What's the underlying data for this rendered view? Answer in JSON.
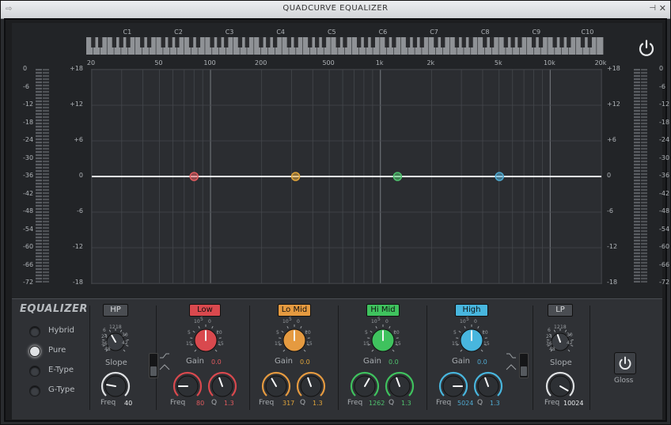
{
  "window": {
    "title": "QUADCURVE EQUALIZER",
    "pin_icon": "pin-icon",
    "close_icon": "close-icon"
  },
  "graph": {
    "notes": [
      "C1",
      "C2",
      "C3",
      "C4",
      "C5",
      "C6",
      "C7",
      "C8",
      "C9",
      "C10"
    ],
    "freq_labels": [
      "20",
      "50",
      "100",
      "200",
      "500",
      "1k",
      "2k",
      "5k",
      "10k",
      "20k"
    ],
    "db_labels": [
      "+18",
      "+12",
      "+6",
      "0",
      "-6",
      "-12",
      "-18"
    ],
    "meter_labels": [
      "0",
      "-6",
      "-12",
      "-18",
      "-24",
      "-30",
      "-36",
      "-42",
      "-48",
      "-54",
      "-60",
      "-66",
      "-72"
    ],
    "curve_gain_db": 0,
    "bands": [
      {
        "name": "Low",
        "freq_hz": 80,
        "color": "#e05a5e"
      },
      {
        "name": "Lo Mid",
        "freq_hz": 317,
        "color": "#e0a43a"
      },
      {
        "name": "Hi Mid",
        "freq_hz": 1262,
        "color": "#4fc26e"
      },
      {
        "name": "High",
        "freq_hz": 5024,
        "color": "#4fa9d0"
      }
    ]
  },
  "controls": {
    "title": "EQUALIZER",
    "modes": [
      {
        "label": "Hybrid",
        "selected": false
      },
      {
        "label": "Pure",
        "selected": true
      },
      {
        "label": "E-Type",
        "selected": false
      },
      {
        "label": "G-Type",
        "selected": false
      }
    ],
    "hp": {
      "button": "HP",
      "slope_label": "Slope",
      "slope_ticks": [
        "6",
        "12",
        "18",
        "24",
        "30",
        "36",
        "42",
        "48"
      ],
      "freq_label": "Freq",
      "freq_value": "40"
    },
    "low": {
      "button": "Low",
      "gain_label": "Gain",
      "gain_value": "0.0",
      "freq_label": "Freq",
      "freq_value": "80",
      "q_label": "Q",
      "q_value": "1.3",
      "color": "#e05a5e"
    },
    "lomid": {
      "button": "Lo Mid",
      "gain_label": "Gain",
      "gain_value": "0.0",
      "freq_label": "Freq",
      "freq_value": "317",
      "q_label": "Q",
      "q_value": "1.3",
      "color": "#e0a43a"
    },
    "himid": {
      "button": "Hi Mid",
      "gain_label": "Gain",
      "gain_value": "0.0",
      "freq_label": "Freq",
      "freq_value": "1262",
      "q_label": "Q",
      "q_value": "1.3",
      "color": "#4fc26e"
    },
    "high": {
      "button": "High",
      "gain_label": "Gain",
      "gain_value": "0.0",
      "freq_label": "Freq",
      "freq_value": "5024",
      "q_label": "Q",
      "q_value": "1.3",
      "color": "#4fa9d0"
    },
    "lp": {
      "button": "LP",
      "slope_label": "Slope",
      "slope_ticks": [
        "6",
        "12",
        "18",
        "24",
        "30",
        "36",
        "42",
        "48"
      ],
      "freq_label": "Freq",
      "freq_value": "10024"
    },
    "gain_ticks": [
      "10",
      "5",
      "0",
      "5",
      "10",
      "15",
      "15"
    ],
    "gloss_label": "Gloss"
  }
}
